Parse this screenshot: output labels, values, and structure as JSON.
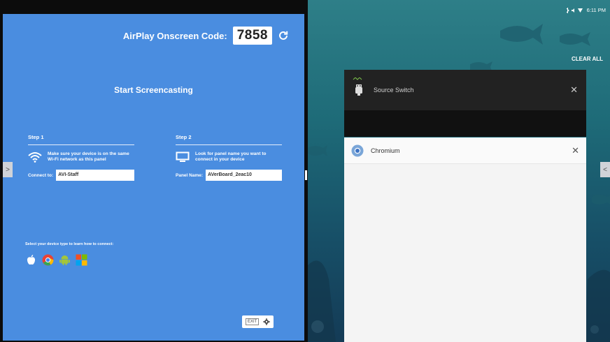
{
  "left_panel": {
    "airplay_label": "AirPlay Onscreen Code:",
    "airplay_code": "7858",
    "title": "Start Screencasting",
    "step1": {
      "title": "Step 1",
      "text": "Make sure your device is on the same Wi-Fi network as this panel",
      "field_label": "Connect to:",
      "field_value": "AVI-Staff"
    },
    "step2": {
      "title": "Step 2",
      "text": "Look for panel name you want to connect in your device",
      "field_label": "Panel Name:",
      "field_value": "AVerBoard_2eac10"
    },
    "device_caption": "Select your device type to learn how to connect:",
    "device_icons": [
      "apple-icon",
      "chrome-icon",
      "android-icon",
      "windows-icon"
    ],
    "exit_label": "EXIT",
    "accent_color": "#4a8de0"
  },
  "side_tabs": {
    "left": ">",
    "right": "<"
  },
  "right_panel": {
    "status_time": "6:11 PM",
    "clear_all": "CLEAR ALL",
    "cards": [
      {
        "title": "Source Switch",
        "icon": "source-switch-icon"
      },
      {
        "title": "Chromium",
        "icon": "chromium-icon"
      }
    ]
  }
}
